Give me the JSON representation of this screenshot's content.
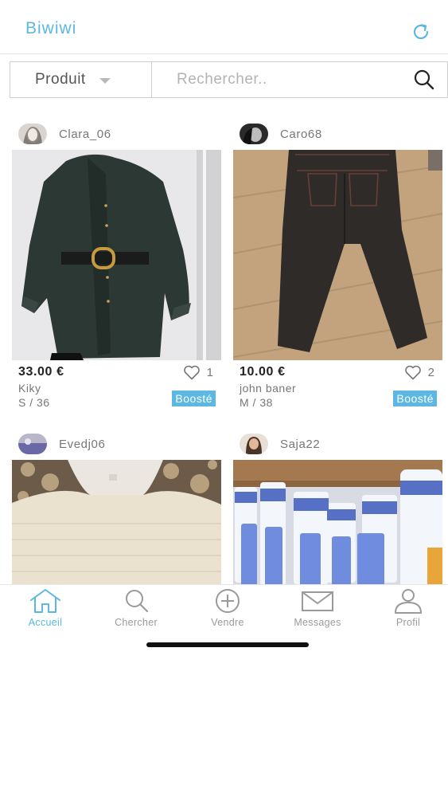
{
  "app": {
    "title": "Biwiwi"
  },
  "colors": {
    "accent": "#5cb8e2",
    "text": "#333333",
    "muted": "#777777",
    "border": "#cfcfcf"
  },
  "search": {
    "filter_label": "Produit",
    "placeholder": "Rechercher.."
  },
  "listings": [
    {
      "username": "Clara_06",
      "price": "33.00 €",
      "likes": "1",
      "brand": "Kiky",
      "size": "S / 36",
      "badge": "Boosté",
      "photo": "dark corduroy ruffle dress with belt"
    },
    {
      "username": "Caro68",
      "price": "10.00 €",
      "likes": "2",
      "brand": "john baner",
      "size": "M / 38",
      "badge": "Boosté",
      "photo": "dark jeans on wooden floor"
    },
    {
      "username": "Evedj06",
      "photo": "cream knit sweater"
    },
    {
      "username": "Saja22",
      "photo": "skincare tubes and bottles"
    }
  ],
  "tabs": [
    {
      "label": "Accueil",
      "icon": "home-icon",
      "active": true
    },
    {
      "label": "Chercher",
      "icon": "search-icon",
      "active": false
    },
    {
      "label": "Vendre",
      "icon": "plus-circle-icon",
      "active": false
    },
    {
      "label": "Messages",
      "icon": "envelope-icon",
      "active": false
    },
    {
      "label": "Profil",
      "icon": "user-icon",
      "active": false
    }
  ]
}
